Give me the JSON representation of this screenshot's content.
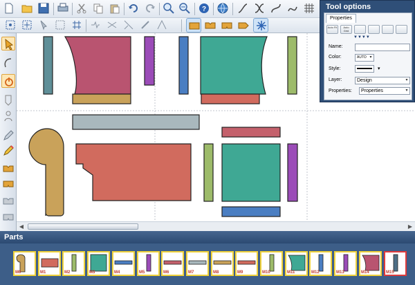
{
  "toolbar": {
    "items": [
      "new-icon",
      "open-icon",
      "save-icon",
      "print-icon",
      "cut-icon",
      "copy-icon",
      "paste-icon",
      "undo-icon",
      "redo-icon",
      "zoom-in-icon",
      "zoom-out-icon",
      "help-icon",
      "globe-icon",
      "curve-icon",
      "cross-curve-icon",
      "s-curve-icon",
      "wave-icon",
      "grid-icon"
    ],
    "row2": [
      "node-icon",
      "node-move-icon",
      "pin-icon",
      "align-icon",
      "mesh-icon",
      "link-icon",
      "split-icon",
      "warp-icon",
      "snap-icon",
      "grade-icon",
      "notch-icon",
      "notch2-icon",
      "notch3-icon",
      "notch4-icon",
      "burst-icon"
    ]
  },
  "left_tools": [
    "select-arrow-icon",
    "arc-icon",
    "power-icon",
    "piece-icon",
    "person-icon",
    "pen-icon",
    "pencil-icon",
    "notch-tool-icon",
    "notch-tool2-icon",
    "notch-tool3-icon",
    "notch-tool4-icon"
  ],
  "tool_options": {
    "title": "Tool options",
    "tab": "Properties",
    "buttons": [
      "Auto Fit",
      "Auto Grid"
    ],
    "name_label": "Name:",
    "name_value": "",
    "color_label": "Color:",
    "color_value": "AUTO",
    "style_label": "Style:",
    "layer_label": "Layer:",
    "layer_value": "Design",
    "properties_label": "Properties:",
    "properties_value": "Properties"
  },
  "parts": {
    "title": "Parts",
    "items": [
      {
        "label": "M0",
        "color": "#c9a25a",
        "shape": "tall-round"
      },
      {
        "label": "M1",
        "color": "#d16b5e",
        "shape": "wide"
      },
      {
        "label": "M2",
        "color": "#9dbb6a",
        "shape": "slim"
      },
      {
        "label": "M3",
        "color": "#3fa894",
        "shape": "square"
      },
      {
        "label": "M4",
        "color": "#4a7ec2",
        "shape": "bar"
      },
      {
        "label": "M5",
        "color": "#9b4cb8",
        "shape": "slim"
      },
      {
        "label": "M6",
        "color": "#c4616c",
        "shape": "bar"
      },
      {
        "label": "M7",
        "color": "#a9b8bd",
        "shape": "bar"
      },
      {
        "label": "M8",
        "color": "#c9a25a",
        "shape": "bar"
      },
      {
        "label": "M9",
        "color": "#d16b5e",
        "shape": "bar"
      },
      {
        "label": "M10",
        "color": "#9dbb6a",
        "shape": "slim"
      },
      {
        "label": "M11",
        "color": "#3fa894",
        "shape": "trap"
      },
      {
        "label": "M12",
        "color": "#4a7ec2",
        "shape": "slim"
      },
      {
        "label": "M13",
        "color": "#9b4cb8",
        "shape": "slim"
      },
      {
        "label": "M14",
        "color": "#b95470",
        "shape": "trap"
      },
      {
        "label": "M15",
        "color": "#4e6f86",
        "shape": "slim"
      }
    ]
  },
  "colors": {
    "accent": "#2f4f78",
    "canvas": "#ffffff",
    "part_border": "#f0d23a",
    "part_selected": "#e03b3b"
  }
}
